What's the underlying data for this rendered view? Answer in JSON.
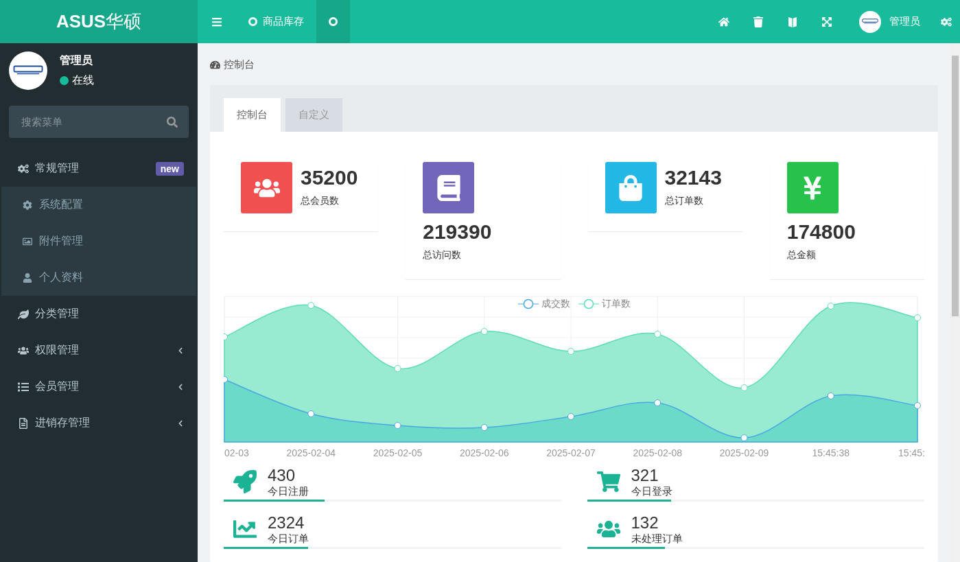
{
  "brand": {
    "name": "ASUS",
    "suffix": "华硕"
  },
  "top_tabs": [
    {
      "label": "商品库存",
      "selected": false
    },
    {
      "selected": true
    }
  ],
  "user": {
    "name": "管理员",
    "status": "在线",
    "top_name": "管理员"
  },
  "search": {
    "placeholder": "搜索菜单"
  },
  "menu": [
    {
      "label": "常规管理",
      "badge": "new",
      "expanded": true,
      "has_children": false,
      "children": [
        {
          "label": "系统配置"
        },
        {
          "label": "附件管理"
        },
        {
          "label": "个人资料"
        }
      ]
    },
    {
      "label": "分类管理",
      "expanded": false,
      "has_children": false
    },
    {
      "label": "权限管理",
      "expanded": false,
      "has_children": true
    },
    {
      "label": "会员管理",
      "expanded": false,
      "has_children": true
    },
    {
      "label": "进销存管理",
      "expanded": false,
      "has_children": true
    }
  ],
  "breadcrumb": "控制台",
  "panel_tabs": [
    {
      "label": "控制台",
      "selected": true
    },
    {
      "label": "自定义",
      "selected": false
    }
  ],
  "stats": [
    {
      "value": "35200",
      "label": "总会员数",
      "color": "#f05050",
      "kind": "inline"
    },
    {
      "value": "219390",
      "label": "总访问数",
      "color": "#7266ba",
      "kind": "stacked"
    },
    {
      "value": "32143",
      "label": "总订单数",
      "color": "#23b7e5",
      "kind": "inline"
    },
    {
      "value": "174800",
      "label": "总金额",
      "color": "#27c24c",
      "kind": "stacked"
    }
  ],
  "chart": {
    "legend": [
      "成交数",
      "订单数"
    ],
    "x_labels": [
      "02-03",
      "2025-02-04",
      "2025-02-05",
      "2025-02-06",
      "2025-02-07",
      "2025-02-08",
      "2025-02-09",
      "15:45:38",
      "15:45:"
    ]
  },
  "today": [
    {
      "value": "430",
      "label": "今日注册",
      "level": 0.3
    },
    {
      "value": "321",
      "label": "今日登录",
      "level": 0.25
    },
    {
      "value": "2324",
      "label": "今日订单",
      "level": 0.25
    },
    {
      "value": "132",
      "label": "未处理订单",
      "level": 0.23
    }
  ]
}
